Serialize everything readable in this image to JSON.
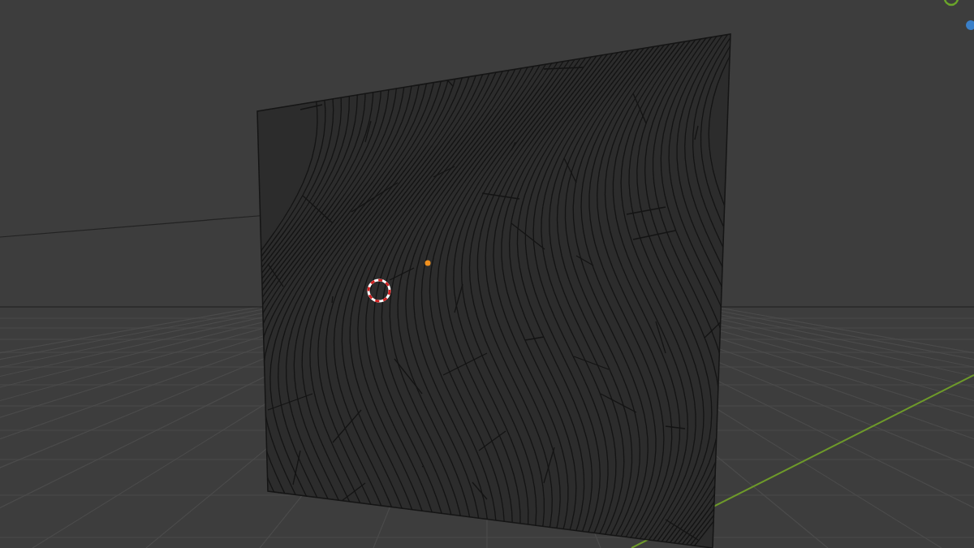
{
  "viewport": {
    "objects": [
      {
        "kind": "grid"
      },
      {
        "kind": "x-axis"
      },
      {
        "kind": "mesh"
      },
      {
        "kind": "origin"
      },
      {
        "kind": "cursor"
      },
      {
        "kind": "gizmo"
      }
    ]
  }
}
